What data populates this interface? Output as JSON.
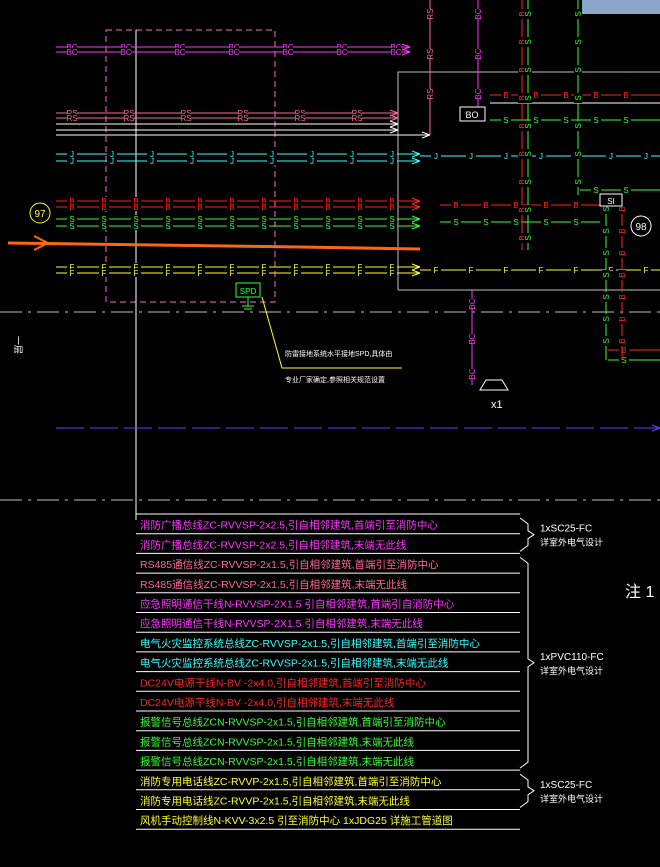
{
  "colors": {
    "bg": "#000000",
    "magenta": "#ff33ff",
    "pink": "#ff6699",
    "white": "#ffffff",
    "cyan": "#33ffff",
    "red": "#ff2222",
    "green": "#33ff33",
    "yellow": "#ffff33",
    "purple": "#6a3cff",
    "orange": "#ff6611",
    "gray": "#bfbfbf",
    "blue": "#8aa6c8"
  },
  "line_codes": {
    "bc": "BC",
    "rs": "RS",
    "j": "J",
    "b": "B",
    "s": "S",
    "f": "F"
  },
  "labels": {
    "circle_97": "97",
    "circle_98": "98",
    "bo": "BO",
    "si": "SI",
    "spd": "SPD",
    "x1": "x1",
    "left_margin": "一层",
    "note_right": "注 1",
    "spd_note_line1": "防雷接地系统水平接地SPD,具体由",
    "spd_note_line2": "专业厂家确定,参照相关规范设置"
  },
  "legend": [
    {
      "text": "消防广播总线ZC-RVVSP-2x2.5,引自相邻建筑,首端引至消防中心",
      "color": "magenta"
    },
    {
      "text": "消防广播总线ZC-RVVSP-2x2.5,引自相邻建筑,末端无此线",
      "color": "magenta"
    },
    {
      "text": "RS485通信线ZC-RVVSP-2x1.5,引自相邻建筑,首端引至消防中心",
      "color": "pink"
    },
    {
      "text": "RS485通信线ZC-RVVSP-2x1.5,引自相邻建筑,末端无此线",
      "color": "pink"
    },
    {
      "text": "应急照明通信干线N-RVVSP-2X1.5   引自相邻建筑,首端引自消防中心",
      "color": "magenta"
    },
    {
      "text": "应急照明通信干线N-RVVSP-2X1.5   引自相邻建筑,末端无此线",
      "color": "magenta"
    },
    {
      "text": "电气火灾监控系统总线ZC-RVVSP-2x1.5,引自相邻建筑,首端引至消防中心",
      "color": "cyan"
    },
    {
      "text": "电气火灾监控系统总线ZC-RVVSP-2x1.5,引自相邻建筑,末端无此线",
      "color": "cyan"
    },
    {
      "text": "DC24V电源干线N-BV -2x4.0,引自相邻建筑,首端引至消防中心",
      "color": "red"
    },
    {
      "text": "DC24V电源干线N-BV -2x4.0,引自相邻建筑,末端无此线",
      "color": "red"
    },
    {
      "text": "报警信号总线ZCN-RVVSP-2x1.5,引自相邻建筑,首端引至消防中心",
      "color": "green"
    },
    {
      "text": "报警信号总线ZCN-RVVSP-2x1.5,引自相邻建筑,末端无此线",
      "color": "green"
    },
    {
      "text": "报警信号总线ZCN-RVVSP-2x1.5,引自相邻建筑,末端无此线",
      "color": "green"
    },
    {
      "text": "消防专用电话线ZC-RVVP-2x1.5,引自相邻建筑,首端引至消防中心",
      "color": "yellow"
    },
    {
      "text": "消防专用电话线ZC-RVVP-2x1.5,引自相邻建筑,末端无此线",
      "color": "yellow"
    },
    {
      "text": "风机手动控制线N-KVV-3x2.5  引至消防中心  1xJDG25  详施工管道图",
      "color": "yellow"
    }
  ],
  "brackets": [
    {
      "line1": "1xSC25-FC",
      "line2": "详室外电气设计"
    },
    {
      "line1": "1xPVC110-FC",
      "line2": "详室外电气设计"
    },
    {
      "line1": "1xSC25-FC",
      "line2": "详室外电气设计"
    }
  ]
}
